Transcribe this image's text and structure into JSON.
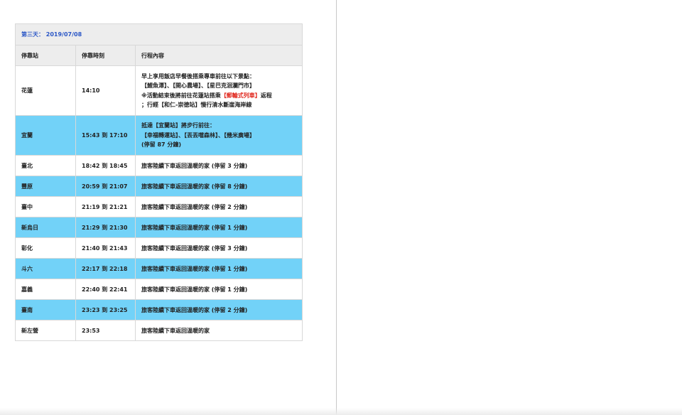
{
  "schedule": {
    "day_title": "第三天： 2019/07/08",
    "headers": {
      "station": "停靠站",
      "time": "停靠時刻",
      "content": "行程內容"
    },
    "rows": [
      {
        "station": "花蓮",
        "time": "14:10",
        "desc": {
          "line1": "早上享用飯店早餐後搭乘專車前往以下景點：",
          "line2": "【鯉魚潭】、【開心農場】、【星巴克洄瀾門市】",
          "line3_prefix": "※活動結束後將前往花蓮站搭乘",
          "line3_highlight": "【郵輪式列車】",
          "line3_suffix": "返程",
          "line4": "；行經【和仁-崇德站】慢行清水斷崖海岸線"
        },
        "highlight": false
      },
      {
        "station": "宜蘭",
        "time": "15:43 到 17:10",
        "desc": {
          "line1": "抵達【宜蘭站】將步行前往：",
          "line2": "【幸福轉運站】、【丟丟噹森林】、【幾米廣場】",
          "line3": "(停留 87 分鐘)"
        },
        "highlight": true
      },
      {
        "station": "臺北",
        "time": "18:42 到 18:45",
        "desc": "旅客陸續下車返回溫暖的家 (停留 3 分鐘)",
        "highlight": false
      },
      {
        "station": "豐原",
        "time": "20:59 到 21:07",
        "desc": "旅客陸續下車返回溫暖的家 (停留 8 分鐘)",
        "highlight": true
      },
      {
        "station": "臺中",
        "time": "21:19 到 21:21",
        "desc": "旅客陸續下車返回溫暖的家 (停留 2 分鐘)",
        "highlight": false
      },
      {
        "station": "新烏日",
        "time": "21:29 到 21:30",
        "desc": "旅客陸續下車返回溫暖的家 (停留 1 分鐘)",
        "highlight": true
      },
      {
        "station": "彰化",
        "time": "21:40 到 21:43",
        "desc": "旅客陸續下車返回溫暖的家 (停留 3 分鐘)",
        "highlight": false
      },
      {
        "station": "斗六",
        "time": "22:17 到 22:18",
        "desc": "旅客陸續下車返回溫暖的家 (停留 1 分鐘)",
        "highlight": true
      },
      {
        "station": "嘉義",
        "time": "22:40 到 22:41",
        "desc": "旅客陸續下車返回溫暖的家 (停留 1 分鐘)",
        "highlight": false
      },
      {
        "station": "臺南",
        "time": "23:23 到 23:25",
        "desc": "旅客陸續下車返回溫暖的家 (停留 2 分鐘)",
        "highlight": true
      },
      {
        "station": "新左營",
        "time": "23:53",
        "desc": "旅客陸續下車返回溫暖的家",
        "highlight": false
      }
    ]
  },
  "colors": {
    "highlight_row": "#72d2f8",
    "header_bg": "#ededed",
    "day_title_text": "#2a56c6",
    "emphasis_red": "#e0241a"
  }
}
